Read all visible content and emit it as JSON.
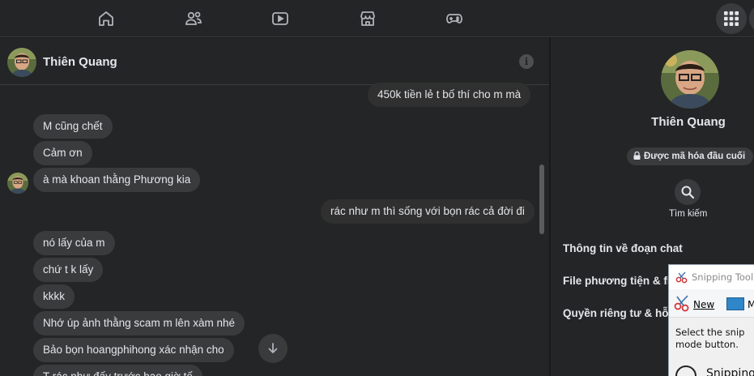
{
  "contact": {
    "name": "Thiên Quang"
  },
  "messages": [
    {
      "dir": "out",
      "text": "450k tiền lẻ t bố thí cho m mà"
    },
    {
      "dir": "in",
      "text": "M cũng chết"
    },
    {
      "dir": "in",
      "text": "Cảm ơn"
    },
    {
      "dir": "in",
      "text": "à mà khoan thằng Phương kia"
    },
    {
      "dir": "out",
      "text": "rác như m thì sống với bọn rác cả đời đi"
    },
    {
      "dir": "in",
      "text": "nó lấy của m"
    },
    {
      "dir": "in",
      "text": "chứ t k lấy"
    },
    {
      "dir": "in",
      "text": "kkkk"
    },
    {
      "dir": "in",
      "text": "Nhớ úp ảnh thằng scam m lên xàm nhé"
    },
    {
      "dir": "in",
      "text": "Bảo bọn hoangphihong xác nhận cho"
    },
    {
      "dir": "in",
      "text": "T rác như đấy trước bao giờ tế"
    }
  ],
  "side_panel": {
    "name": "Thiên Quang",
    "encryption_badge": "Được mã hóa đầu cuối",
    "search_label": "Tìm kiếm",
    "sections": [
      "Thông tin về đoạn chat",
      "File phương tiện & file",
      "Quyền riêng tư & hỗ trợ"
    ]
  },
  "snipping_tool": {
    "title": "Snipping Tool",
    "new_label": "New",
    "mode_label": "M",
    "instructions": "Select the snip mode button.",
    "bottom_label": "Snipping"
  },
  "colors": {
    "background": "#18191a",
    "panel": "#242526",
    "bubble": "#3a3b3c"
  }
}
